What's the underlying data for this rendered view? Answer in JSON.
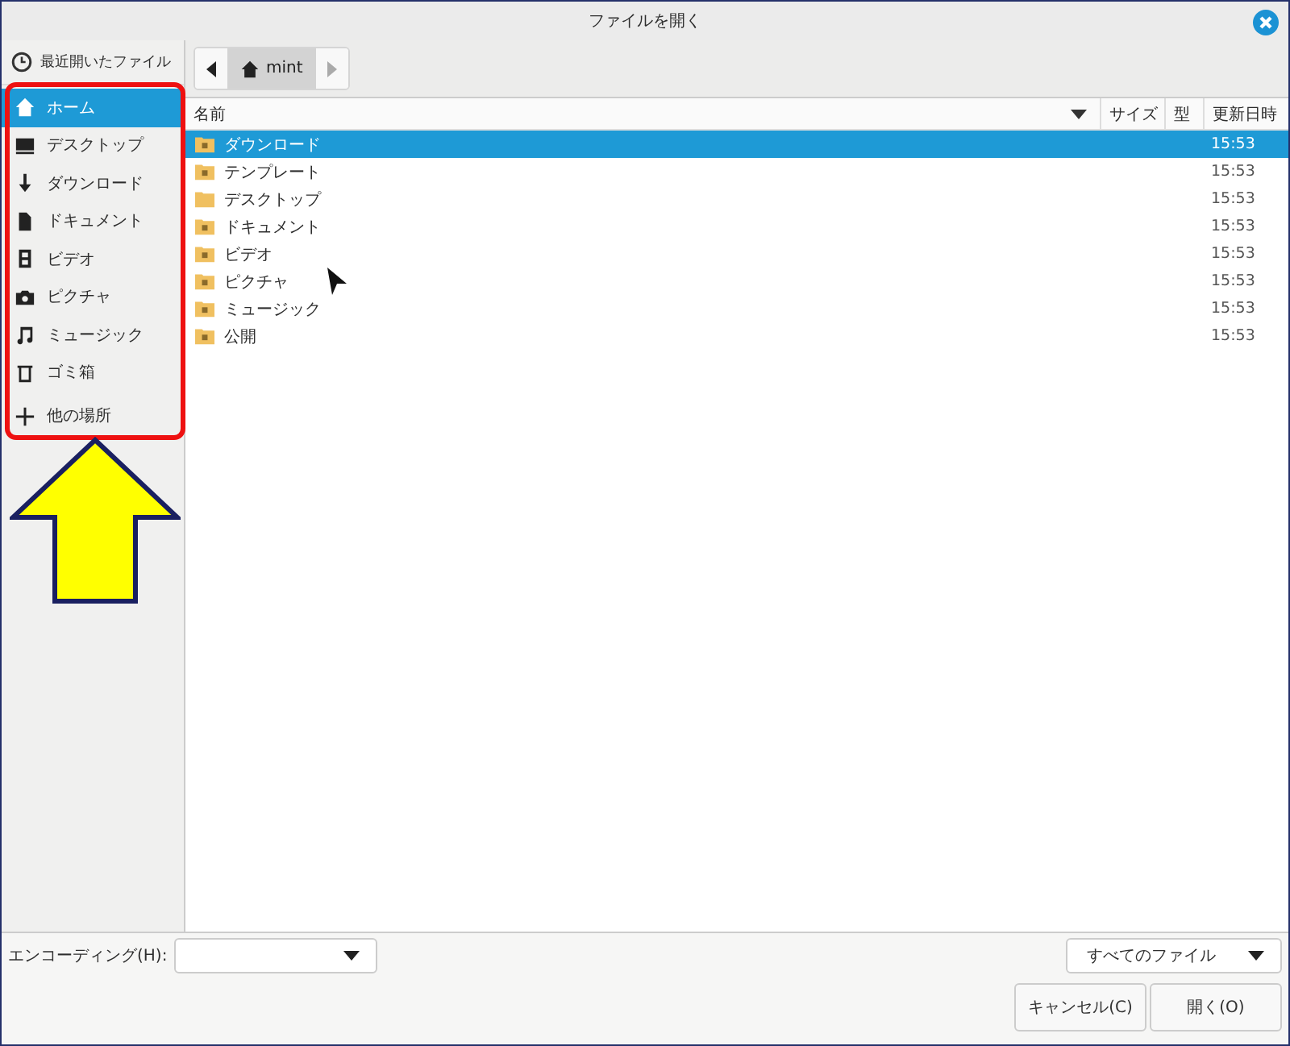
{
  "window": {
    "title": "ファイルを開く"
  },
  "sidebar": {
    "recent": {
      "label": "最近開いたファイル",
      "kind": "recent"
    },
    "items": [
      {
        "label": "ホーム",
        "kind": "home",
        "selected": true
      },
      {
        "label": "デスクトップ",
        "kind": "desktop",
        "selected": false
      },
      {
        "label": "ダウンロード",
        "kind": "download",
        "selected": false
      },
      {
        "label": "ドキュメント",
        "kind": "document",
        "selected": false
      },
      {
        "label": "ビデオ",
        "kind": "video",
        "selected": false
      },
      {
        "label": "ピクチャ",
        "kind": "picture",
        "selected": false
      },
      {
        "label": "ミュージック",
        "kind": "music",
        "selected": false
      },
      {
        "label": "ゴミ箱",
        "kind": "trash",
        "selected": false
      }
    ],
    "other": {
      "label": "他の場所",
      "kind": "add"
    }
  },
  "path_bar": {
    "segments": [
      {
        "label": "mint",
        "selected": true
      }
    ]
  },
  "table": {
    "columns": [
      "名前",
      "サイズ",
      "型",
      "更新日時"
    ],
    "rows": [
      {
        "name": "ダウンロード",
        "kind": "download",
        "modified": "15:53",
        "selected": true
      },
      {
        "name": "テンプレート",
        "kind": "template",
        "modified": "15:53",
        "selected": false
      },
      {
        "name": "デスクトップ",
        "kind": "desktop",
        "modified": "15:53",
        "selected": false
      },
      {
        "name": "ドキュメント",
        "kind": "document",
        "modified": "15:53",
        "selected": false
      },
      {
        "name": "ビデオ",
        "kind": "video",
        "modified": "15:53",
        "selected": false
      },
      {
        "name": "ピクチャ",
        "kind": "picture",
        "modified": "15:53",
        "selected": false
      },
      {
        "name": "ミュージック",
        "kind": "music",
        "modified": "15:53",
        "selected": false
      },
      {
        "name": "公開",
        "kind": "share",
        "modified": "15:53",
        "selected": false
      }
    ]
  },
  "encoding": {
    "label": "エンコーディング(H):"
  },
  "filter": {
    "value": "すべてのファイル"
  },
  "buttons": [
    {
      "label": "キャンセル(C)"
    },
    {
      "label": "開く(O)"
    }
  ]
}
